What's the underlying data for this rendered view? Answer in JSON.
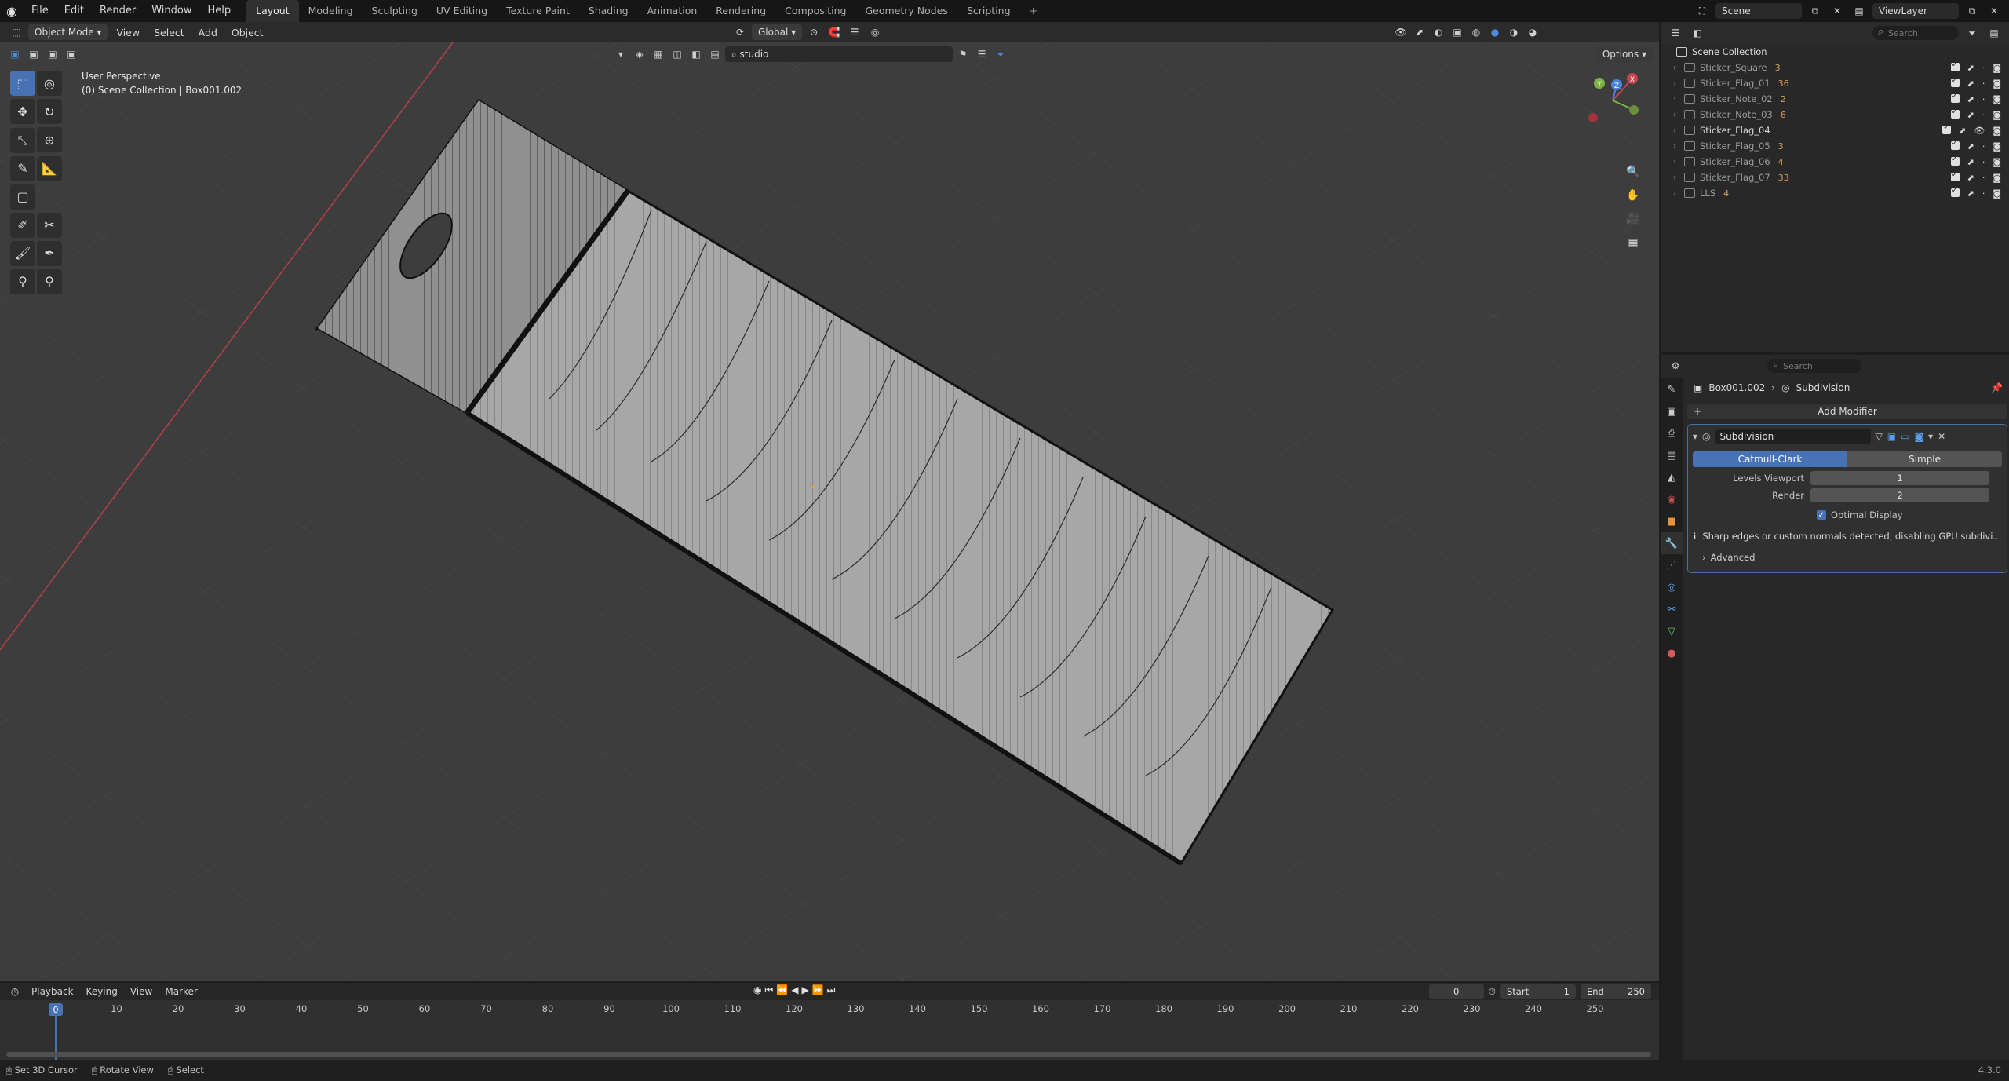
{
  "menu": [
    "File",
    "Edit",
    "Render",
    "Window",
    "Help"
  ],
  "workspaces": [
    "Layout",
    "Modeling",
    "Sculpting",
    "UV Editing",
    "Texture Paint",
    "Shading",
    "Animation",
    "Rendering",
    "Compositing",
    "Geometry Nodes",
    "Scripting"
  ],
  "workspace_plus": "+",
  "scene": "Scene",
  "viewlayer": "ViewLayer",
  "viewport": {
    "mode": "Object Mode",
    "menus": [
      "View",
      "Select",
      "Add",
      "Object"
    ],
    "transform_orientation": "Global",
    "options": "Options",
    "filter_text": "studio",
    "perspective": "User Perspective",
    "collection_info": "(0) Scene Collection | Box001.002",
    "gizmo_axes": {
      "x": "X",
      "y": "Y",
      "z": "Z"
    }
  },
  "outliner": {
    "search_placeholder": "Search",
    "root": "Scene Collection",
    "items": [
      {
        "name": "Sticker_Square",
        "badge": "3"
      },
      {
        "name": "Sticker_Flag_01",
        "badge": "36"
      },
      {
        "name": "Sticker_Note_02",
        "badge": "2"
      },
      {
        "name": "Sticker_Note_03",
        "badge": "6"
      },
      {
        "name": "Sticker_Flag_04",
        "badge": ""
      },
      {
        "name": "Sticker_Flag_05",
        "badge": "3"
      },
      {
        "name": "Sticker_Flag_06",
        "badge": "4"
      },
      {
        "name": "Sticker_Flag_07",
        "badge": "33"
      },
      {
        "name": "LLS",
        "badge": "4"
      }
    ]
  },
  "properties": {
    "search_placeholder": "Search",
    "object": "Box001.002",
    "modifier_crumb": "Subdivision",
    "add_modifier": "Add Modifier",
    "modifier_name": "Subdivision",
    "catmull": "Catmull-Clark",
    "simple": "Simple",
    "levels_label": "Levels Viewport",
    "levels_value": "1",
    "render_label": "Render",
    "render_value": "2",
    "optimal_display": "Optimal Display",
    "warning": "Sharp edges or custom normals detected, disabling GPU subdivi...",
    "advanced": "Advanced"
  },
  "timeline": {
    "menus": [
      "Playback",
      "Keying",
      "View",
      "Marker"
    ],
    "current_frame": "0",
    "start_label": "Start",
    "start": "1",
    "end_label": "End",
    "end": "250",
    "playhead": "0",
    "ticks": [
      "10",
      "20",
      "30",
      "40",
      "50",
      "60",
      "70",
      "80",
      "90",
      "100",
      "110",
      "120",
      "130",
      "140",
      "150",
      "160",
      "170",
      "180",
      "190",
      "200",
      "210",
      "220",
      "230",
      "240",
      "250"
    ]
  },
  "status": {
    "cursor": "Set 3D Cursor",
    "rotate": "Rotate View",
    "select": "Select",
    "version": "4.3.0"
  },
  "colors": {
    "accent": "#4772b3",
    "x_axis": "#c7444d",
    "y_axis": "#7cb342",
    "z_axis": "#4a84d6"
  }
}
